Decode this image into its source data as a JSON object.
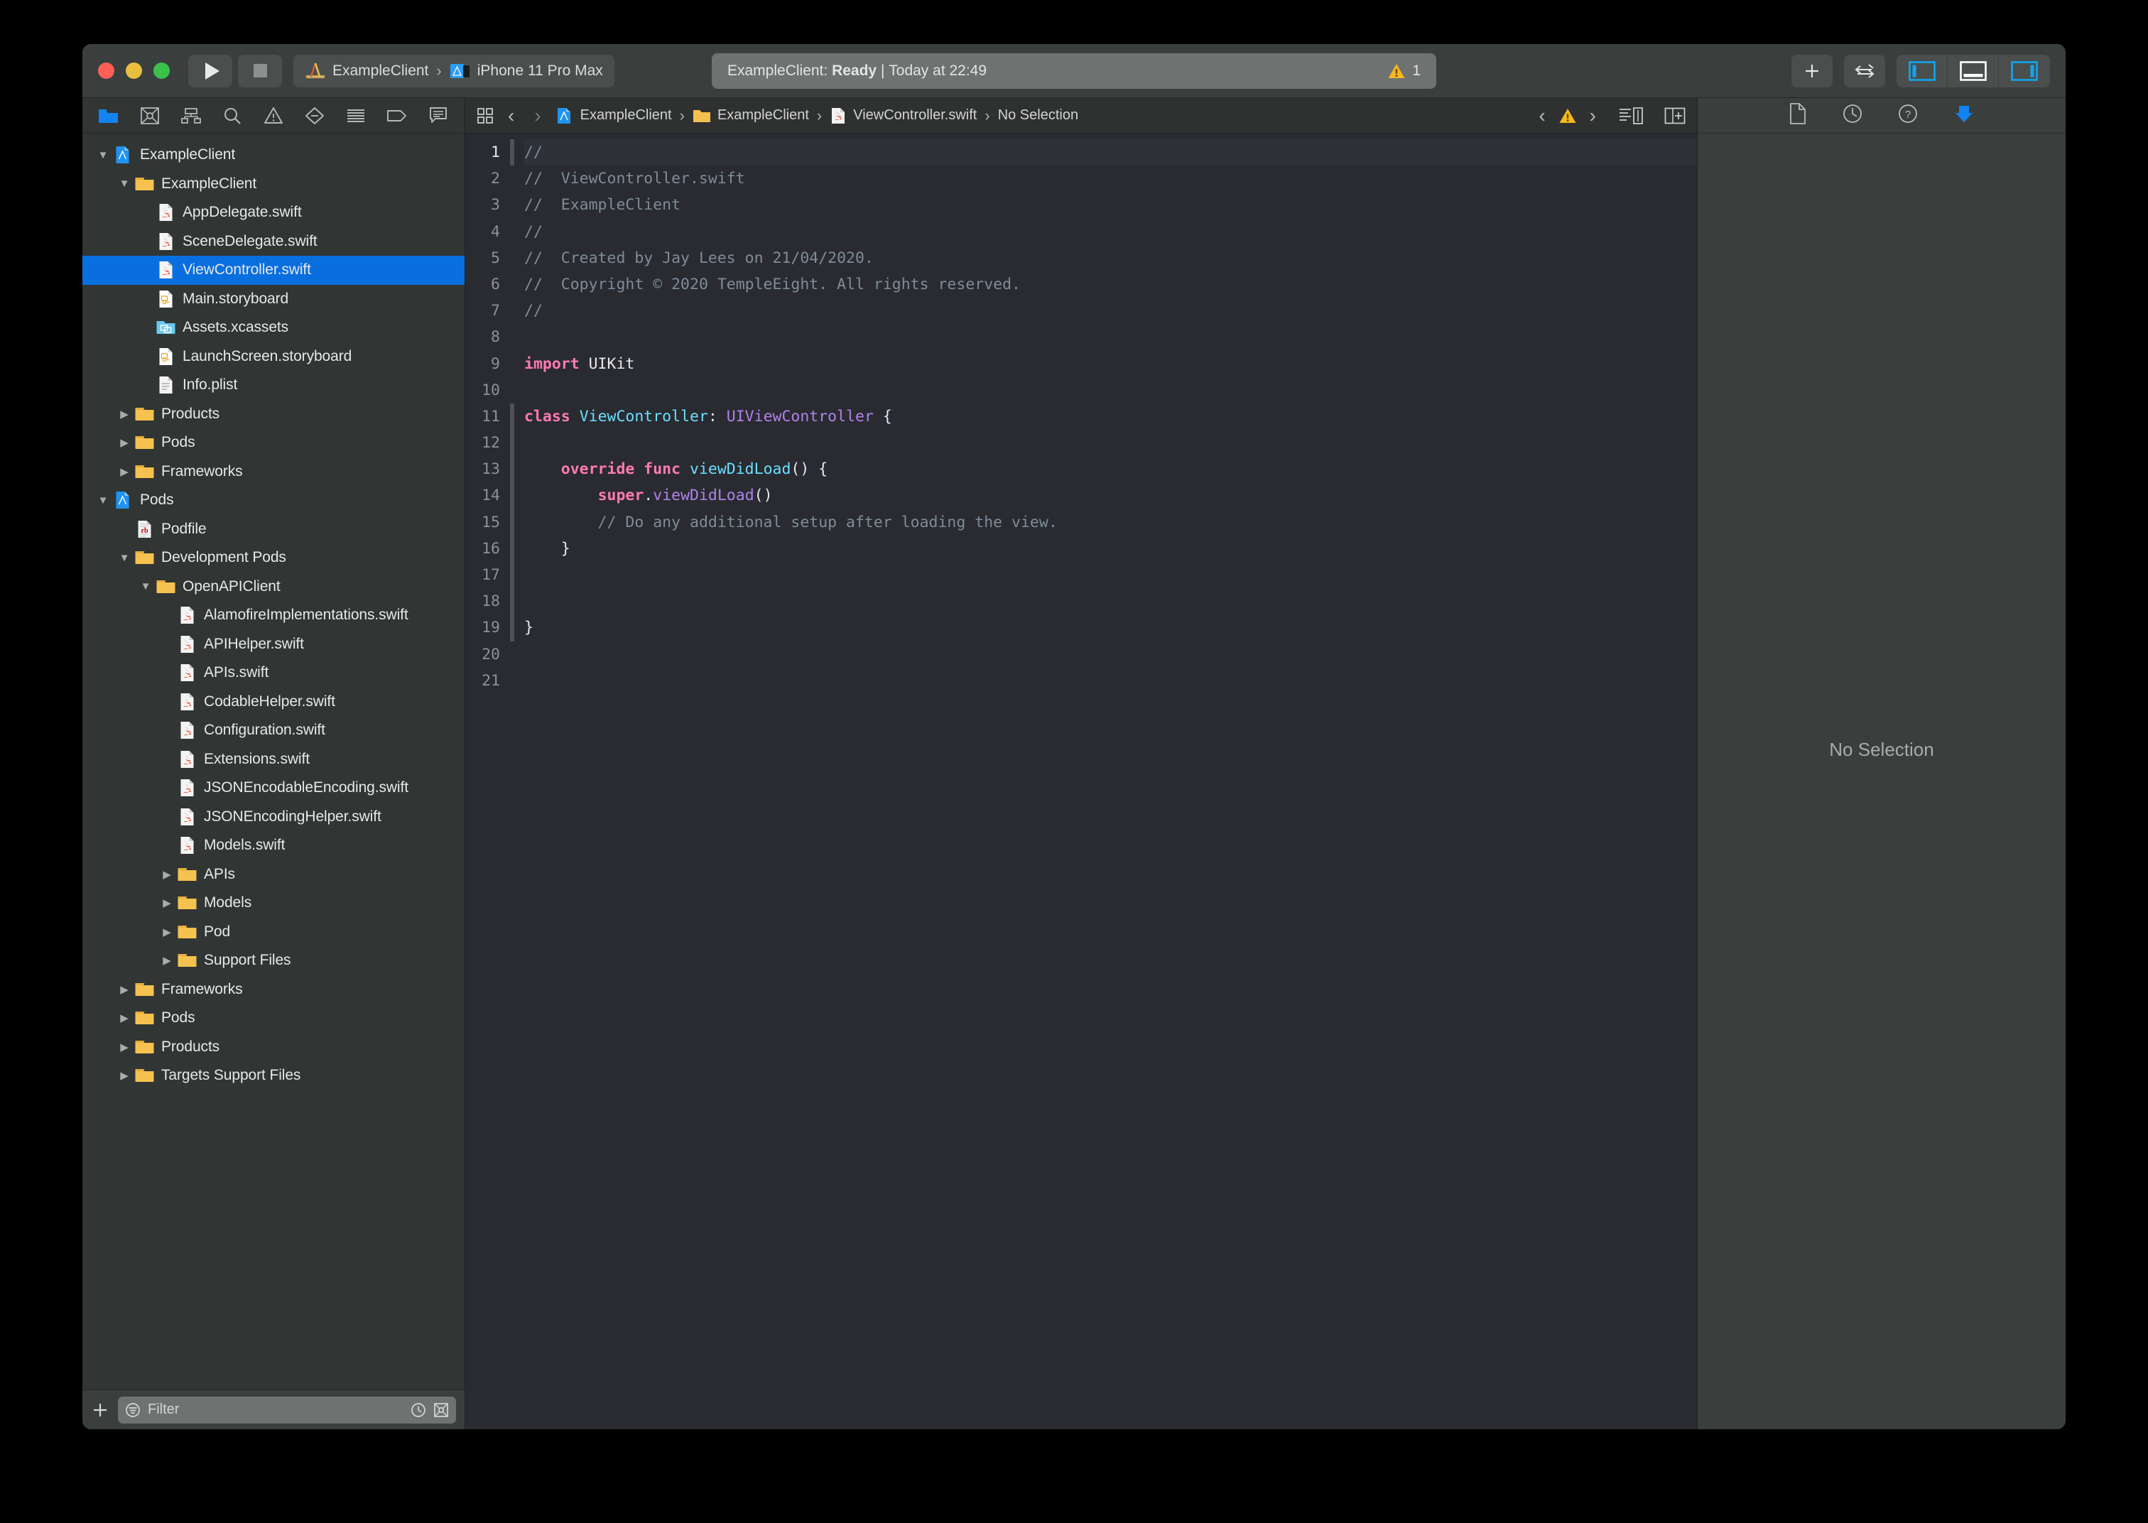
{
  "window": {
    "traffic_lights": [
      "close",
      "minimize",
      "zoom"
    ],
    "colors": {
      "accent_blue": "#096fdf",
      "titlebar_bg": "#3a3f3e",
      "navigator_bg": "#313534",
      "editor_bg": "#292b31",
      "inspector_bg": "#3a3f3e",
      "warning_yellow": "#f5b721"
    }
  },
  "toolbar": {
    "run_label": "Run",
    "stop_label": "Stop",
    "scheme": {
      "project": "ExampleClient",
      "separator": "›",
      "destination": "iPhone 11 Pro Max",
      "project_icon": "xcode-scheme-icon",
      "destination_icon": "simulator-icon"
    },
    "status": {
      "prefix": "ExampleClient:",
      "state": "Ready",
      "divider": "|",
      "time": "Today at 22:49",
      "warning_count": "1"
    },
    "add_label": "+",
    "swap_label": "⇄",
    "panels": {
      "left_label": "Navigator",
      "bottom_label": "Debug Area",
      "right_label": "Inspector",
      "left_active": true,
      "bottom_active": false,
      "right_active": true
    }
  },
  "navigator": {
    "tabs": [
      {
        "name": "project-navigator",
        "icon": "folder-icon",
        "active": true
      },
      {
        "name": "source-control-navigator",
        "icon": "source-control-icon",
        "active": false
      },
      {
        "name": "symbol-navigator",
        "icon": "hierarchy-icon",
        "active": false
      },
      {
        "name": "find-navigator",
        "icon": "search-icon",
        "active": false
      },
      {
        "name": "issue-navigator",
        "icon": "warning-triangle-icon",
        "active": false
      },
      {
        "name": "test-navigator",
        "icon": "diamond-icon",
        "active": false
      },
      {
        "name": "debug-navigator",
        "icon": "lines-icon",
        "active": false
      },
      {
        "name": "breakpoint-navigator",
        "icon": "tag-icon",
        "active": false
      },
      {
        "name": "report-navigator",
        "icon": "speech-bubble-icon",
        "active": false
      }
    ],
    "tree": [
      {
        "label": "ExampleClient",
        "depth": 0,
        "icon": "xcodeproj",
        "arrow": "down",
        "selected": false
      },
      {
        "label": "ExampleClient",
        "depth": 1,
        "icon": "folder",
        "arrow": "down",
        "selected": false
      },
      {
        "label": "AppDelegate.swift",
        "depth": 2,
        "icon": "swift",
        "arrow": "none",
        "selected": false
      },
      {
        "label": "SceneDelegate.swift",
        "depth": 2,
        "icon": "swift",
        "arrow": "none",
        "selected": false
      },
      {
        "label": "ViewController.swift",
        "depth": 2,
        "icon": "swift",
        "arrow": "none",
        "selected": true
      },
      {
        "label": "Main.storyboard",
        "depth": 2,
        "icon": "storyboard",
        "arrow": "none",
        "selected": false
      },
      {
        "label": "Assets.xcassets",
        "depth": 2,
        "icon": "xcassets",
        "arrow": "none",
        "selected": false
      },
      {
        "label": "LaunchScreen.storyboard",
        "depth": 2,
        "icon": "storyboard",
        "arrow": "none",
        "selected": false
      },
      {
        "label": "Info.plist",
        "depth": 2,
        "icon": "plist",
        "arrow": "none",
        "selected": false
      },
      {
        "label": "Products",
        "depth": 1,
        "icon": "folder",
        "arrow": "right",
        "selected": false
      },
      {
        "label": "Pods",
        "depth": 1,
        "icon": "folder",
        "arrow": "right",
        "selected": false
      },
      {
        "label": "Frameworks",
        "depth": 1,
        "icon": "folder",
        "arrow": "right",
        "selected": false
      },
      {
        "label": "Pods",
        "depth": 0,
        "icon": "xcodeproj",
        "arrow": "down",
        "selected": false
      },
      {
        "label": "Podfile",
        "depth": 1,
        "icon": "ruby",
        "arrow": "none",
        "selected": false
      },
      {
        "label": "Development Pods",
        "depth": 1,
        "icon": "folder",
        "arrow": "down",
        "selected": false
      },
      {
        "label": "OpenAPIClient",
        "depth": 2,
        "icon": "folder",
        "arrow": "down",
        "selected": false
      },
      {
        "label": "AlamofireImplementations.swift",
        "depth": 3,
        "icon": "swift",
        "arrow": "none",
        "selected": false
      },
      {
        "label": "APIHelper.swift",
        "depth": 3,
        "icon": "swift",
        "arrow": "none",
        "selected": false
      },
      {
        "label": "APIs.swift",
        "depth": 3,
        "icon": "swift",
        "arrow": "none",
        "selected": false
      },
      {
        "label": "CodableHelper.swift",
        "depth": 3,
        "icon": "swift",
        "arrow": "none",
        "selected": false
      },
      {
        "label": "Configuration.swift",
        "depth": 3,
        "icon": "swift",
        "arrow": "none",
        "selected": false
      },
      {
        "label": "Extensions.swift",
        "depth": 3,
        "icon": "swift",
        "arrow": "none",
        "selected": false
      },
      {
        "label": "JSONEncodableEncoding.swift",
        "depth": 3,
        "icon": "swift",
        "arrow": "none",
        "selected": false
      },
      {
        "label": "JSONEncodingHelper.swift",
        "depth": 3,
        "icon": "swift",
        "arrow": "none",
        "selected": false
      },
      {
        "label": "Models.swift",
        "depth": 3,
        "icon": "swift",
        "arrow": "none",
        "selected": false
      },
      {
        "label": "APIs",
        "depth": 3,
        "icon": "folder",
        "arrow": "right",
        "selected": false
      },
      {
        "label": "Models",
        "depth": 3,
        "icon": "folder",
        "arrow": "right",
        "selected": false
      },
      {
        "label": "Pod",
        "depth": 3,
        "icon": "folder",
        "arrow": "right",
        "selected": false
      },
      {
        "label": "Support Files",
        "depth": 3,
        "icon": "folder",
        "arrow": "right",
        "selected": false
      },
      {
        "label": "Frameworks",
        "depth": 1,
        "icon": "folder",
        "arrow": "right",
        "selected": false
      },
      {
        "label": "Pods",
        "depth": 1,
        "icon": "folder",
        "arrow": "right",
        "selected": false
      },
      {
        "label": "Products",
        "depth": 1,
        "icon": "folder",
        "arrow": "right",
        "selected": false
      },
      {
        "label": "Targets Support Files",
        "depth": 1,
        "icon": "folder",
        "arrow": "right",
        "selected": false
      }
    ],
    "footer": {
      "add_label": "+",
      "filter_placeholder": "Filter",
      "filter_value": "",
      "filter_icon": "filter-funnel-icon",
      "recent_icon": "clock-icon",
      "source-control_icon": "source-control-filter-icon"
    }
  },
  "editor": {
    "jumpbar": {
      "related_items_icon": "related-items-icon",
      "back_label": "‹",
      "forward_label": "›",
      "crumbs": [
        {
          "label": "ExampleClient",
          "icon": "xcodeproj"
        },
        {
          "label": "ExampleClient",
          "icon": "folder"
        },
        {
          "label": "ViewController.swift",
          "icon": "swift"
        },
        {
          "label": "No Selection",
          "icon": "none"
        }
      ],
      "issue_prev_label": "‹",
      "issue_next_label": "›",
      "issue_icon": "warning-triangle-icon",
      "minimap_icon": "minimap-icon",
      "add_editor_icon": "add-editor-icon"
    },
    "first_line_number": 1,
    "last_line_number": 21,
    "current_line": 1,
    "fold_lines": [
      1,
      11,
      12,
      13,
      14,
      15,
      16,
      17,
      18,
      19
    ],
    "lines": [
      {
        "n": 1,
        "tokens": [
          {
            "t": "//",
            "c": "cmt"
          }
        ]
      },
      {
        "n": 2,
        "tokens": [
          {
            "t": "//  ViewController.swift",
            "c": "cmt"
          }
        ]
      },
      {
        "n": 3,
        "tokens": [
          {
            "t": "//  ExampleClient",
            "c": "cmt"
          }
        ]
      },
      {
        "n": 4,
        "tokens": [
          {
            "t": "//",
            "c": "cmt"
          }
        ]
      },
      {
        "n": 5,
        "tokens": [
          {
            "t": "//  Created by Jay Lees on 21/04/2020.",
            "c": "cmt"
          }
        ]
      },
      {
        "n": 6,
        "tokens": [
          {
            "t": "//  Copyright © 2020 TempleEight. All rights reserved.",
            "c": "cmt"
          }
        ]
      },
      {
        "n": 7,
        "tokens": [
          {
            "t": "//",
            "c": "cmt"
          }
        ]
      },
      {
        "n": 8,
        "tokens": []
      },
      {
        "n": 9,
        "tokens": [
          {
            "t": "import",
            "c": "kw"
          },
          {
            "t": " UIKit",
            "c": "pln"
          }
        ]
      },
      {
        "n": 10,
        "tokens": []
      },
      {
        "n": 11,
        "tokens": [
          {
            "t": "class",
            "c": "kw"
          },
          {
            "t": " ",
            "c": "pln"
          },
          {
            "t": "ViewController",
            "c": "typ"
          },
          {
            "t": ": ",
            "c": "pln"
          },
          {
            "t": "UIViewController",
            "c": "typ2"
          },
          {
            "t": " {",
            "c": "pln"
          }
        ]
      },
      {
        "n": 12,
        "tokens": []
      },
      {
        "n": 13,
        "tokens": [
          {
            "t": "    ",
            "c": "pln"
          },
          {
            "t": "override func",
            "c": "kw"
          },
          {
            "t": " ",
            "c": "pln"
          },
          {
            "t": "viewDidLoad",
            "c": "typ"
          },
          {
            "t": "() {",
            "c": "pln"
          }
        ]
      },
      {
        "n": 14,
        "tokens": [
          {
            "t": "        ",
            "c": "pln"
          },
          {
            "t": "super",
            "c": "kw"
          },
          {
            "t": ".",
            "c": "pln"
          },
          {
            "t": "viewDidLoad",
            "c": "typ2"
          },
          {
            "t": "()",
            "c": "pln"
          }
        ]
      },
      {
        "n": 15,
        "tokens": [
          {
            "t": "        // Do any additional setup after loading the view.",
            "c": "cmt"
          }
        ]
      },
      {
        "n": 16,
        "tokens": [
          {
            "t": "    }",
            "c": "pln"
          }
        ]
      },
      {
        "n": 17,
        "tokens": []
      },
      {
        "n": 18,
        "tokens": []
      },
      {
        "n": 19,
        "tokens": [
          {
            "t": "}",
            "c": "pln"
          }
        ]
      },
      {
        "n": 20,
        "tokens": []
      },
      {
        "n": 21,
        "tokens": []
      }
    ]
  },
  "inspector": {
    "tabs": [
      {
        "name": "file-inspector",
        "icon": "document-icon",
        "active": false
      },
      {
        "name": "history-inspector",
        "icon": "clock-icon",
        "active": false
      },
      {
        "name": "quick-help-inspector",
        "icon": "question-icon",
        "active": false
      },
      {
        "name": "library-inspector",
        "icon": "package-down-icon",
        "active": true
      }
    ],
    "empty_message": "No Selection"
  }
}
